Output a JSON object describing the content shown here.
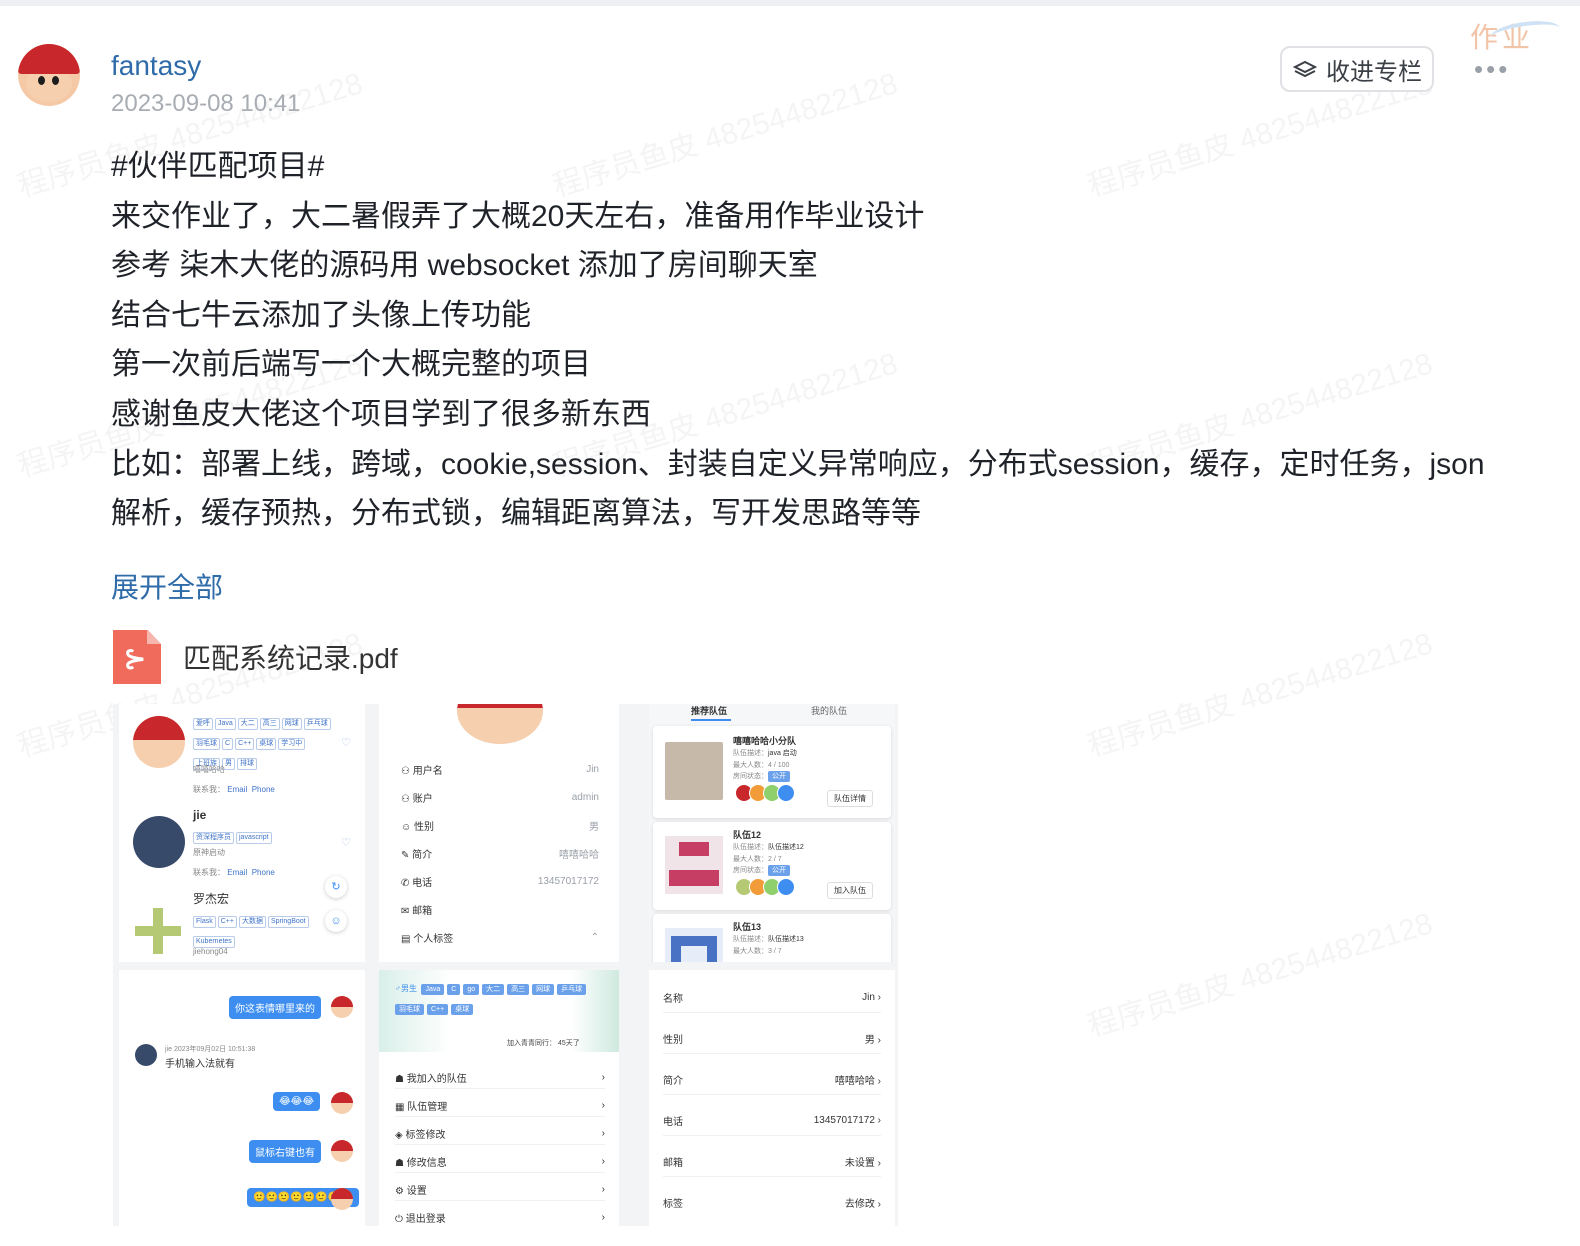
{
  "author": {
    "name": "fantasy",
    "time": "2023-09-08 10:41"
  },
  "corner_tag": "作业",
  "follow_label": "收进专栏",
  "more_label": "•••",
  "watermark": "程序员鱼皮 482544822128",
  "post_lines": [
    "#伙伴匹配项目#",
    "来交作业了，大二暑假弄了大概20天左右，准备用作毕业设计",
    "参考 柒木大佬的源码用 websocket 添加了房间聊天室",
    "结合七牛云添加了头像上传功能",
    "第一次前后端写一个大概完整的项目",
    "感谢鱼皮大佬这个项目学到了很多新东西",
    "比如：部署上线，跨域，cookie,session、封装自定义异常响应，分布式session，缓存，定时任务，json",
    "解析，缓存预热，分布式锁，编辑距离算法，写开发思路等等"
  ],
  "expand_label": "展开全部",
  "attachment": {
    "name": "匹配系统记录.pdf"
  },
  "shot_users": {
    "u1": {
      "tags": [
        "爱呼",
        "Java",
        "大二",
        "高三",
        "网球",
        "乒乓球",
        "羽毛球",
        "C",
        "C++",
        "桌球",
        "学习中",
        "上班族",
        "男",
        "排球"
      ],
      "desc": "嘻嘻哈哈",
      "contact": "联系我：",
      "email": "Email",
      "phone": "Phone"
    },
    "u2": {
      "name": "jie",
      "tags": [
        "资深程序员",
        "javascript"
      ],
      "desc": "原神启动",
      "contact": "联系我：",
      "email": "Email",
      "phone": "Phone"
    },
    "u3": {
      "name": "罗杰宏",
      "tags": [
        "Flask",
        "C++",
        "大数据",
        "SpringBoot",
        "Kubernetes"
      ],
      "desc": "jiehong04"
    }
  },
  "shot_profile": {
    "rows": [
      {
        "label": "用户名",
        "value": "Jin"
      },
      {
        "label": "账户",
        "value": "admin"
      },
      {
        "label": "性别",
        "value": "男"
      },
      {
        "label": "简介",
        "value": "嘻嘻哈哈"
      },
      {
        "label": "电话",
        "value": "13457017172"
      },
      {
        "label": "邮箱",
        "value": ""
      },
      {
        "label": "个人标签",
        "value": ""
      }
    ]
  },
  "shot_teams": {
    "tabs": [
      "推荐队伍",
      "我的队伍"
    ],
    "t1": {
      "name": "嘻嘻哈哈小分队",
      "desc_label": "队伍描述：",
      "desc": "java 启动",
      "max_label": "最大人数：",
      "max": "4 / 100",
      "status_label": "房间状态：",
      "status": "公开",
      "btn": "队伍详情"
    },
    "t2": {
      "name": "队伍12",
      "desc_label": "队伍描述：",
      "desc": "队伍描述12",
      "max_label": "最大人数：",
      "max": "2 / 7",
      "status_label": "房间状态：",
      "status": "公开",
      "btn": "加入队伍"
    },
    "t3": {
      "name": "队伍13",
      "desc_label": "队伍描述：",
      "desc": "队伍描述13",
      "max_label": "最大人数：",
      "max": "3 / 7"
    }
  },
  "shot_chat": {
    "m1": "你这表情哪里来的",
    "sender": "jie  2023年09月02日 10:51:38",
    "m2": "手机输入法就有",
    "m3": "😂😂😂",
    "m4": "鼠标右键也有",
    "m5": "🙂🙂🙂🙂🙂🙂🙂🙂"
  },
  "shot_menu": {
    "gender": "♂男生",
    "tags": [
      "Java",
      "C",
      "go",
      "大二",
      "高三",
      "网球",
      "乒乓球",
      "羽毛球",
      "C++",
      "桌球"
    ],
    "joined": "加入青青同行：",
    "days": "45天了",
    "items": [
      "我加入的队伍",
      "队伍管理",
      "标签修改",
      "修改信息",
      "设置",
      "退出登录"
    ]
  },
  "shot_edit": {
    "rows": [
      {
        "label": "名称",
        "value": "Jin"
      },
      {
        "label": "性别",
        "value": "男"
      },
      {
        "label": "简介",
        "value": "嘻嘻哈哈"
      },
      {
        "label": "电话",
        "value": "13457017172"
      },
      {
        "label": "邮箱",
        "value": "未设置"
      },
      {
        "label": "标签",
        "value": "去修改"
      }
    ]
  }
}
